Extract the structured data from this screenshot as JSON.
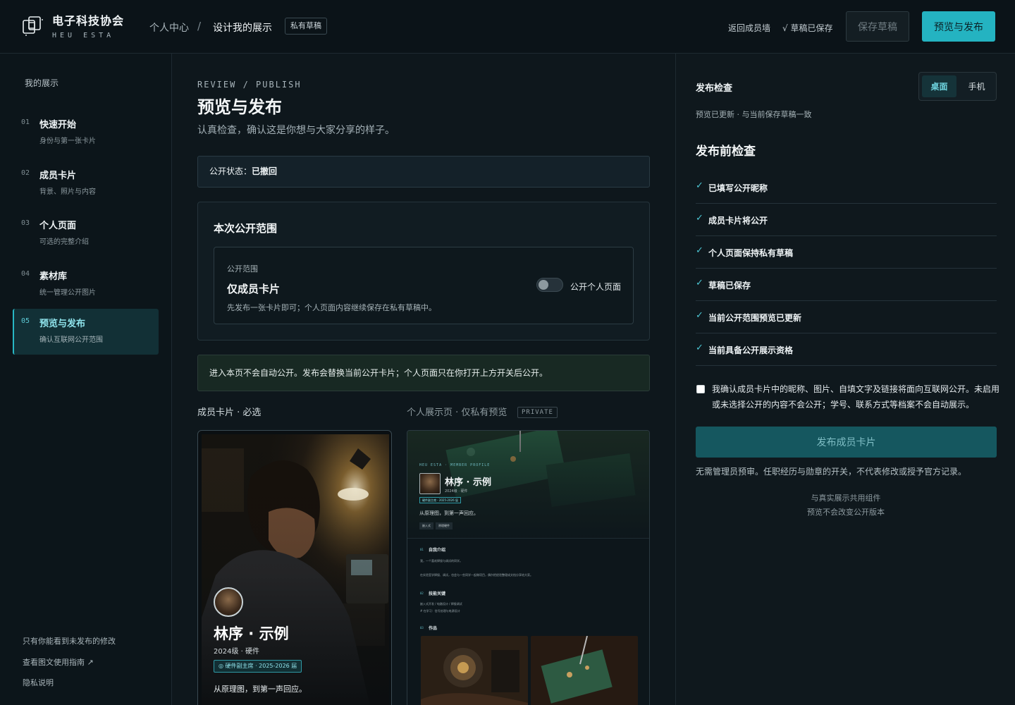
{
  "header": {
    "brand_name": "电子科技协会",
    "brand_sub": "HEU ESTA",
    "breadcrumb": [
      "个人中心",
      "设计我的展示"
    ],
    "breadcrumb_sep": "/",
    "draft_badge": "私有草稿",
    "back_link": "返回成员墙",
    "saved_status": "√ 草稿已保存",
    "save_draft_label": "保存草稿",
    "publish_label": "预览与发布"
  },
  "sidebar": {
    "title": "我的展示",
    "items": [
      {
        "num": "01",
        "label": "快速开始",
        "sub": "身份与第一张卡片"
      },
      {
        "num": "02",
        "label": "成员卡片",
        "sub": "背景、照片与内容"
      },
      {
        "num": "03",
        "label": "个人页面",
        "sub": "可选的完整介绍"
      },
      {
        "num": "04",
        "label": "素材库",
        "sub": "统一管理公开图片"
      },
      {
        "num": "05",
        "label": "预览与发布",
        "sub": "确认互联网公开范围",
        "active": true
      }
    ],
    "footer": [
      "只有你能看到未发布的修改",
      "查看图文使用指南 ↗",
      "隐私说明"
    ]
  },
  "main": {
    "eyebrow": "REVIEW / PUBLISH",
    "title": "预览与发布",
    "subtitle": "认真检查，确认这是你想与大家分享的样子。",
    "status_label": "公开状态：",
    "status_value": "已撤回",
    "scope": {
      "title": "本次公开范围",
      "label": "公开范围",
      "value": "仅成员卡片",
      "desc": "先发布一张卡片即可；个人页面内容继续保存在私有草稿中。",
      "toggle_label": "公开个人页面",
      "toggle_on": false
    },
    "notice": "进入本页不会自动公开。发布会替换当前公开卡片；个人页面只在你打开上方开关后公开。",
    "card_heading": "成员卡片 · 必选",
    "page_heading": "个人展示页 · 仅私有预览",
    "private_tag": "PRIVATE",
    "member_card": {
      "name": "林序 · 示例",
      "meta": "2024级 · 硬件",
      "badge": "◎ 硬件副主席 · 2025-2026 届",
      "motto": "从原理图，到第一声回应。"
    },
    "page_preview": {
      "kicker": "HEU ESTA · MEMBER PROFILE",
      "name": "林序 · 示例",
      "meta": "2024级 · 硬件",
      "badge": "硬件副主席 · 2025-2026 届",
      "motto": "从原理图，到第一声回应。",
      "tags": [
        "嵌入式",
        "原理硬件"
      ],
      "sections": [
        {
          "num": "01",
          "title": "自我介绍",
          "lines": [
            "我，一个喜欢焊接与调试的同学。",
            "在实验室学焊接、调试，也会与一些同学一起做项目，偶尔把经验整理成文档分享给大家。"
          ]
        },
        {
          "num": "02",
          "title": "技能关键",
          "lines": [
            "嵌入式开发 / 电路设计 / 焊接调试",
            "# 在学习：信号处理与电源设计"
          ]
        },
        {
          "num": "03",
          "title": "作品",
          "lines": []
        }
      ]
    }
  },
  "right": {
    "title": "发布检查",
    "view_desktop": "桌面",
    "view_mobile": "手机",
    "preview_status": "预览已更新 · 与当前保存草稿一致",
    "check_title": "发布前检查",
    "checks": [
      "已填写公开昵称",
      "成员卡片将公开",
      "个人页面保持私有草稿",
      "草稿已保存",
      "当前公开范围预览已更新",
      "当前具备公开展示资格"
    ],
    "check_mark": "✓",
    "confirm_text": "我确认成员卡片中的昵称、图片、自填文字及链接将面向互联网公开。未启用或未选择公开的内容不会公开；学号、联系方式等档案不会自动展示。",
    "confirm_checked": false,
    "publish_card_label": "发布成员卡片",
    "note": "无需管理员预审。任职经历与勋章的开关，不代表修改或授予官方记录。",
    "foot_1": "与真实展示共用组件",
    "foot_2": "预览不会改变公开版本"
  },
  "colors": {
    "accent": "#24b3c1",
    "background": "#0c1419",
    "success_check": "#4cc5d2"
  }
}
